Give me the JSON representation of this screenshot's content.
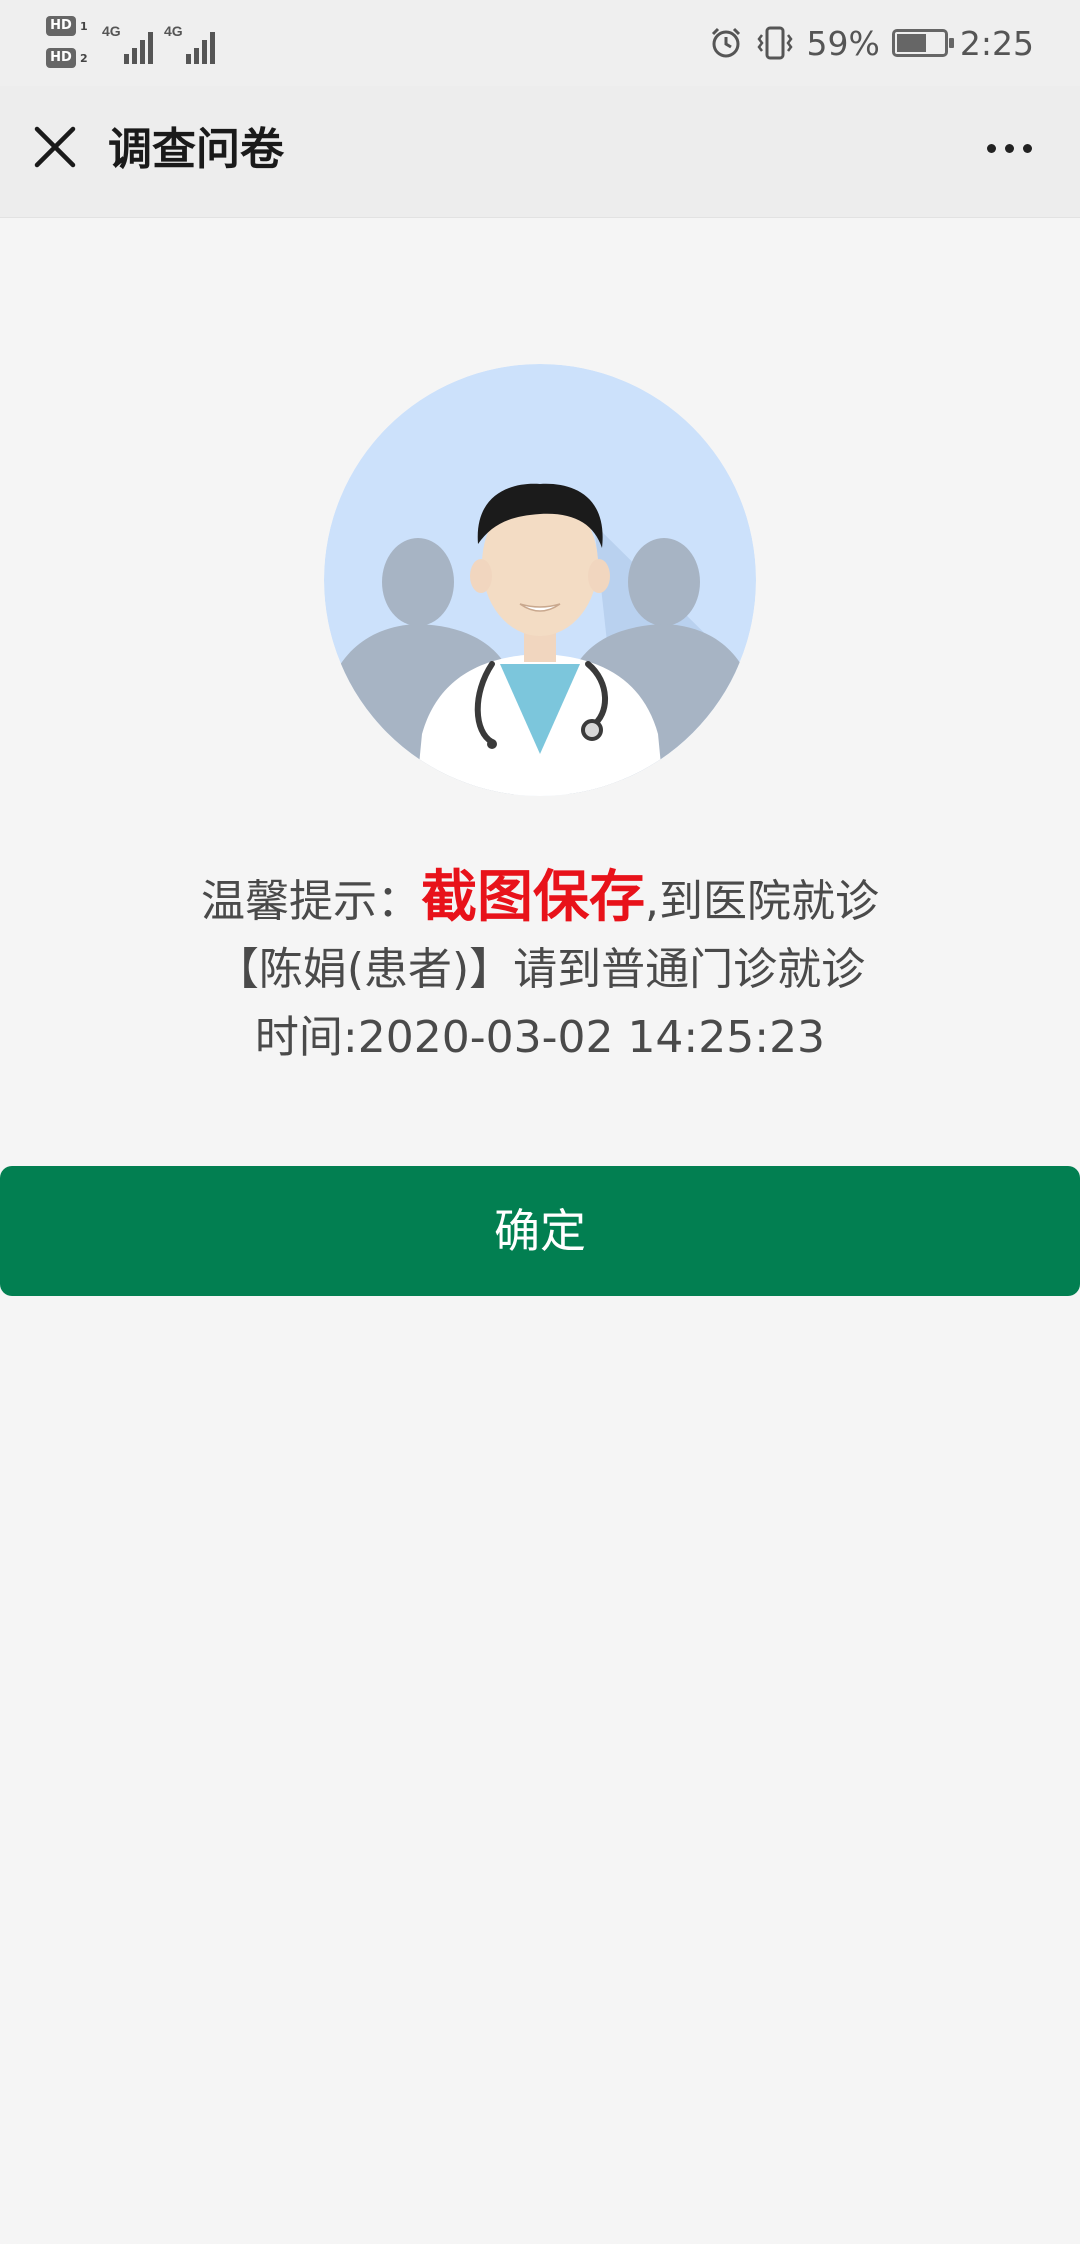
{
  "status_bar": {
    "hd1": "HD",
    "hd1_sub": "1",
    "hd2": "HD",
    "hd2_sub": "2",
    "net1": "4G",
    "net2": "4G",
    "battery_percent": "59%",
    "battery_level": 0.59,
    "time": "2:25"
  },
  "nav": {
    "title": "调查问卷"
  },
  "notice": {
    "prefix": "温馨提示：",
    "highlight": "截图保存",
    "suffix": ",到医院就诊",
    "line2": "【陈娟(患者)】请到普通门诊就诊",
    "line3": "时间:2020-03-02 14:25:23"
  },
  "colors": {
    "primary_button": "#027f51",
    "highlight_text": "#e8121a",
    "avatar_bg": "#cce1fb"
  },
  "confirm_button": {
    "label": "确定"
  }
}
